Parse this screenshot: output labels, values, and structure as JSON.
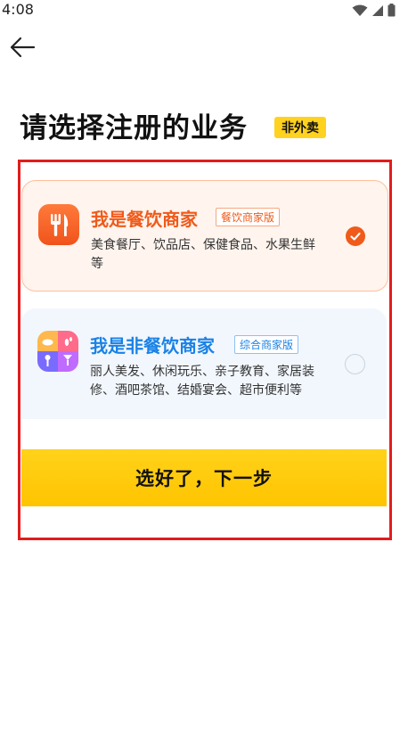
{
  "status_bar": {
    "time": "4:08"
  },
  "header": {
    "title": "请选择注册的业务",
    "badge": "非外卖"
  },
  "options": [
    {
      "title": "我是餐饮商家",
      "tag": "餐饮商家版",
      "description": "美食餐厅、饮品店、保健食品、水果生鲜等",
      "selected": true
    },
    {
      "title": "我是非餐饮商家",
      "tag": "综合商家版",
      "description": "丽人美发、休闲玩乐、亲子教育、家居装修、酒吧茶馆、结婚宴会、超市便利等",
      "selected": false
    }
  ],
  "next_button": {
    "label": "选好了，下一步"
  },
  "colors": {
    "accent_orange": "#f05a1a",
    "accent_blue": "#1a82e6",
    "primary_yellow": "#ffc400",
    "highlight_red": "#e21c1c"
  }
}
